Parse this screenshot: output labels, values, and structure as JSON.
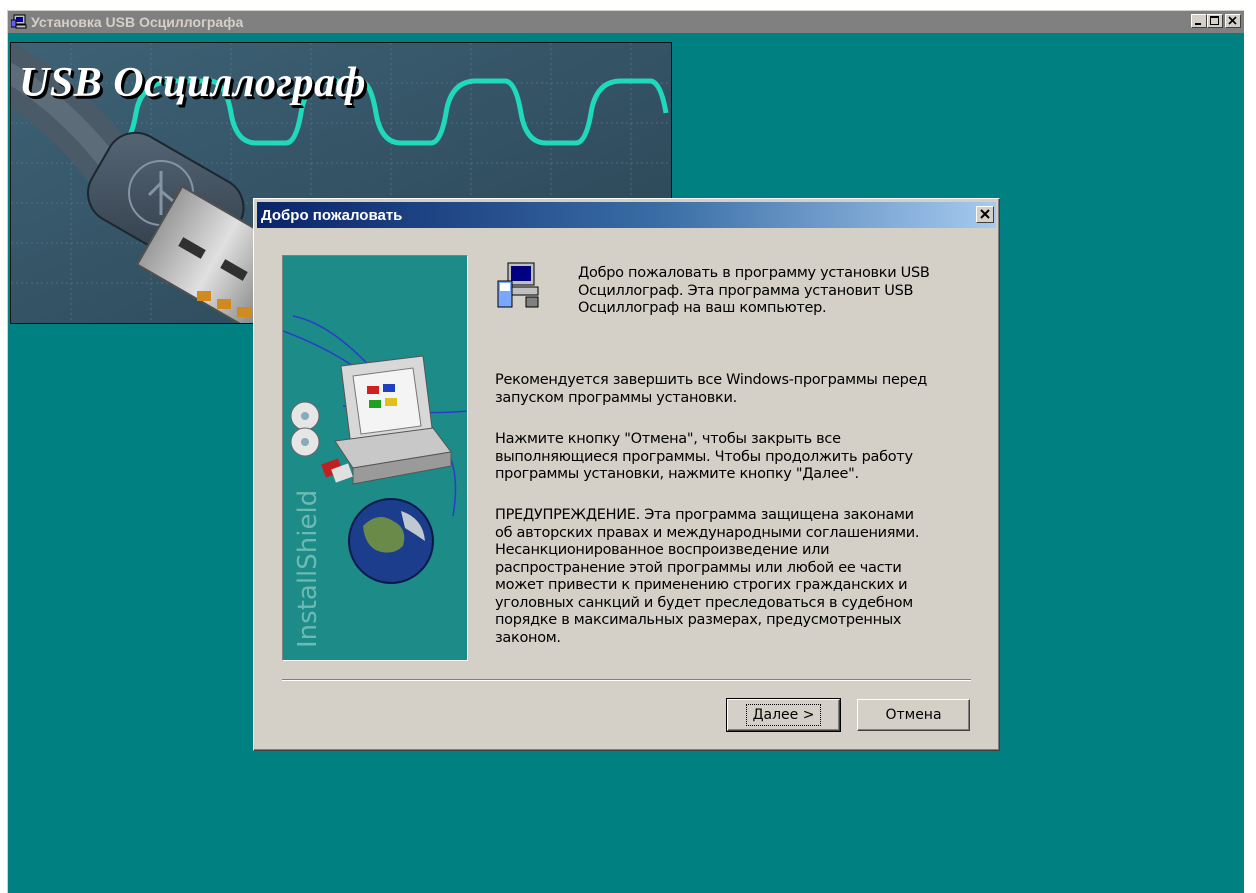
{
  "outer_window": {
    "title": "Установка USB Осциллографа",
    "app_icon": "computer-setup-icon",
    "buttons": [
      "minimize-icon",
      "maximize-icon",
      "close-icon"
    ],
    "background_color": "#008080"
  },
  "banner": {
    "title": "USB Осциллограф",
    "image": "usb-plug-oscilloscope-wave"
  },
  "dialog": {
    "title": "Добро пожаловать",
    "close_icon": "close-icon",
    "side_image_text": "InstallShield",
    "paragraphs": [
      [
        "Добро пожаловать в программу установки USB",
        "Осциллограф. Эта программа установит USB",
        "Осциллограф на ваш компьютер."
      ],
      [
        "Рекомендуется завершить все Windows-программы перед",
        "запуском программы установки."
      ],
      [
        "Нажмите кнопку \"Отмена\", чтобы закрыть все",
        "выполняющиеся программы. Чтобы продолжить работу",
        "программы установки, нажмите кнопку \"Далее\"."
      ],
      [
        "ПРЕДУПРЕЖДЕНИЕ. Эта программа защищена законами",
        "об авторских правах и международными соглашениями.",
        "Несанкционированное воспроизведение или",
        "распространение этой программы или любой ее части",
        "может привести к применению строгих гражданских и",
        "уголовных санкций и будет преследоваться в судебном",
        "порядке в максимальных размерах, предусмотренных",
        "законом."
      ]
    ],
    "next_label": "Далее >",
    "cancel_label": "Отмена"
  }
}
